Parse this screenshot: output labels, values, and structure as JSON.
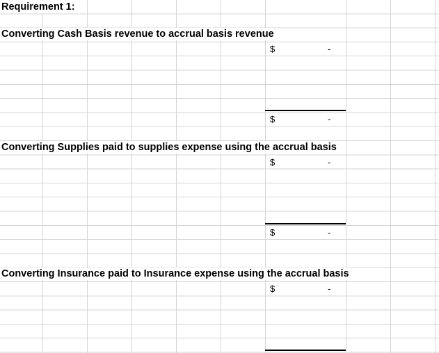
{
  "requirement": {
    "title": "Requirement 1:"
  },
  "sections": [
    {
      "heading": "Converting Cash Basis revenue to accrual basis revenue",
      "top_symbol": "$",
      "top_value": "-",
      "total_symbol": "$",
      "total_value": "-"
    },
    {
      "heading": "Converting Supplies paid to supplies expense using the accrual basis",
      "top_symbol": "$",
      "top_value": "-",
      "total_symbol": "$",
      "total_value": "-"
    },
    {
      "heading": "Converting Insurance paid to Insurance expense using the accrual basis",
      "top_symbol": "$",
      "top_value": "-"
    }
  ]
}
